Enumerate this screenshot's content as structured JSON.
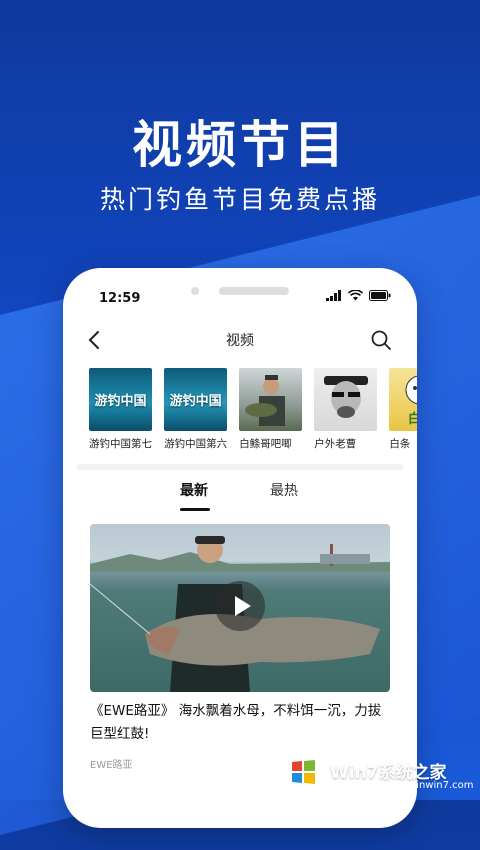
{
  "promo": {
    "headline": "视频节目",
    "subline": "热门钓鱼节目免费点播"
  },
  "status_bar": {
    "time": "12:59"
  },
  "nav": {
    "title": "视频"
  },
  "channels": [
    {
      "label": "游钓中国第七",
      "thumb_text": "游钓中国"
    },
    {
      "label": "游钓中国第六",
      "thumb_text": "游钓中国"
    },
    {
      "label": "白鲦哥吧唧",
      "thumb_text": ""
    },
    {
      "label": "户外老曹",
      "thumb_text": ""
    },
    {
      "label": "白条",
      "thumb_text": "白条"
    }
  ],
  "tabs": [
    {
      "label": "最新",
      "active": true
    },
    {
      "label": "最热",
      "active": false
    }
  ],
  "video": {
    "title": "《EWE路亚》 海水飘着水母，不料饵一沉，力拔巨型红鼓!",
    "source": "EWE路亚"
  },
  "watermark": {
    "text": "Win7系统之家",
    "url": "Www.Winwin7.com"
  },
  "colors": {
    "background": "#1247c4",
    "accent": "#2f74ee"
  }
}
